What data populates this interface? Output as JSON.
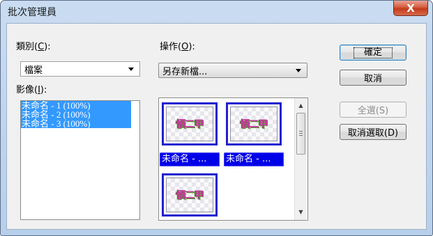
{
  "window": {
    "title": "批次管理員",
    "close_glyph": "X"
  },
  "category": {
    "label_pre": "類別(",
    "label_key": "C",
    "label_post": "):",
    "value": "檔案"
  },
  "images": {
    "label_pre": "影像(",
    "label_key": "I",
    "label_post": "):",
    "items": [
      "未命名 - 1 (100%)",
      "未命名 - 2 (100%)",
      "未命名 - 3 (100%)"
    ]
  },
  "operation": {
    "label_pre": "操作(",
    "label_key": "O",
    "label_post": "):",
    "value": "另存新檔..."
  },
  "thumbnails": {
    "logo_text": "㥧二甲",
    "captions": [
      "未命名 - ...",
      "未命名 - ..."
    ]
  },
  "buttons": {
    "ok": "確定",
    "cancel": "取消",
    "select_all": "全選(S)",
    "deselect": "取消選取(D)"
  },
  "colors": {
    "selection": "#3399ff",
    "thumb_border": "#2020d0",
    "caption_bg": "#0000e8"
  }
}
